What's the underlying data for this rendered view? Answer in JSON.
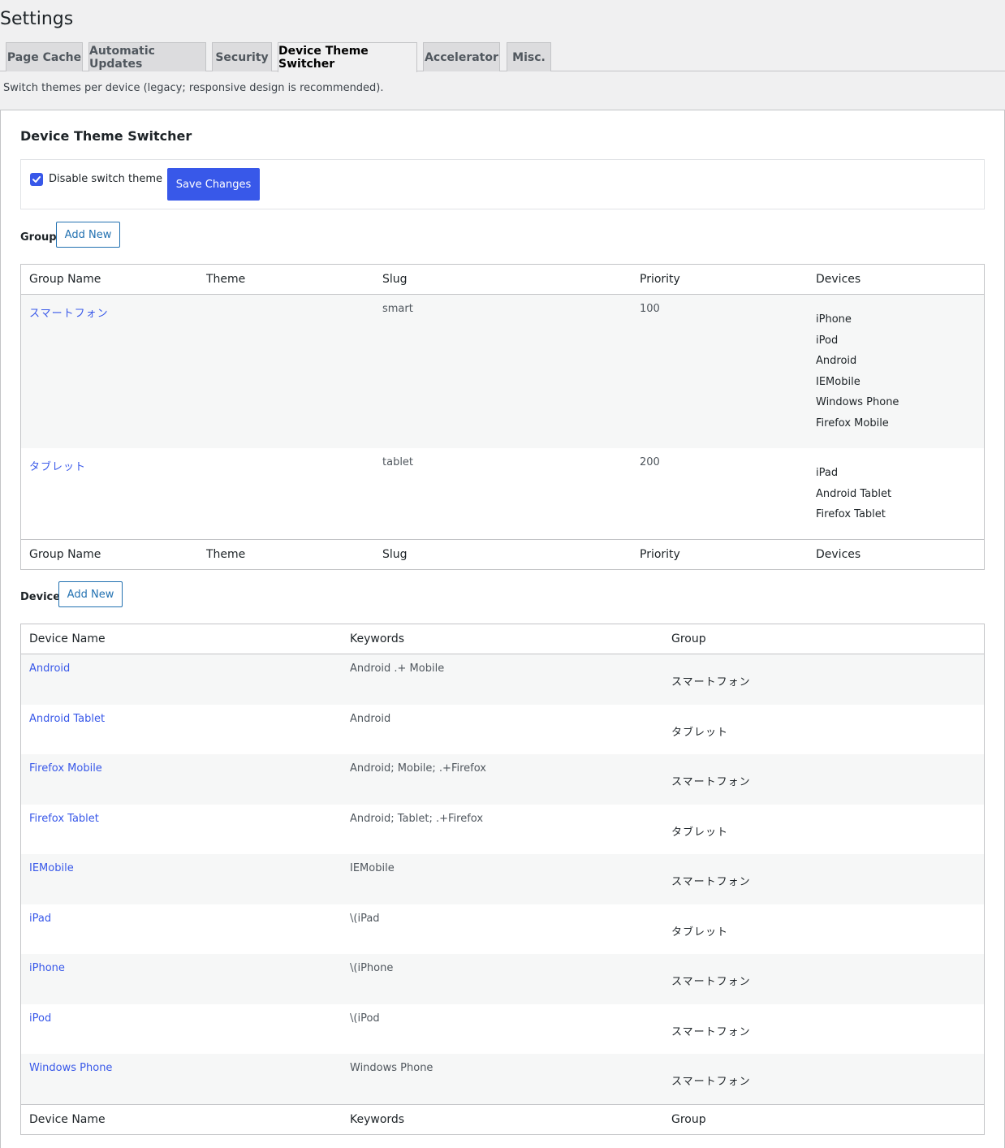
{
  "page": {
    "title": "Settings"
  },
  "tabs": [
    {
      "label": "Page Cache"
    },
    {
      "label": "Automatic Updates"
    },
    {
      "label": "Security"
    },
    {
      "label": "Device Theme Switcher"
    },
    {
      "label": "Accelerator"
    },
    {
      "label": "Misc."
    }
  ],
  "description": "Switch themes per device (legacy; responsive design is recommended).",
  "section": {
    "title": "Device Theme Switcher",
    "disable_switch_label": "Disable switch theme",
    "disable_switch_checked": true,
    "save_label": "Save Changes"
  },
  "group": {
    "label": "Group",
    "add_new": "Add New",
    "columns": [
      "Group Name",
      "Theme",
      "Slug",
      "Priority",
      "Devices"
    ],
    "rows": [
      {
        "name": "スマートフォン",
        "theme": "",
        "slug": "smart",
        "priority": "100",
        "devices": [
          "iPhone",
          "iPod",
          "Android",
          "IEMobile",
          "Windows Phone",
          "Firefox Mobile"
        ]
      },
      {
        "name": "タブレット",
        "theme": "",
        "slug": "tablet",
        "priority": "200",
        "devices": [
          "iPad",
          "Android Tablet",
          "Firefox Tablet"
        ]
      }
    ]
  },
  "device": {
    "label": "Device",
    "add_new": "Add New",
    "columns": [
      "Device Name",
      "Keywords",
      "Group"
    ],
    "rows": [
      {
        "name": "Android",
        "keywords": "Android .+ Mobile",
        "group": "スマートフォン"
      },
      {
        "name": "Android Tablet",
        "keywords": "Android",
        "group": "タブレット"
      },
      {
        "name": "Firefox Mobile",
        "keywords": "Android; Mobile; .+Firefox",
        "group": "スマートフォン"
      },
      {
        "name": "Firefox Tablet",
        "keywords": "Android; Tablet; .+Firefox",
        "group": "タブレット"
      },
      {
        "name": "IEMobile",
        "keywords": "IEMobile",
        "group": "スマートフォン"
      },
      {
        "name": "iPad",
        "keywords": "\\(iPad",
        "group": "タブレット"
      },
      {
        "name": "iPhone",
        "keywords": "\\(iPhone",
        "group": "スマートフォン"
      },
      {
        "name": "iPod",
        "keywords": "\\(iPod",
        "group": "スマートフォン"
      },
      {
        "name": "Windows Phone",
        "keywords": "Windows Phone",
        "group": "スマートフォン"
      }
    ]
  },
  "colors": {
    "accent": "#3858e9",
    "link": "#3858e9",
    "border": "#c3c4c7",
    "background": "#f0f0f1"
  }
}
